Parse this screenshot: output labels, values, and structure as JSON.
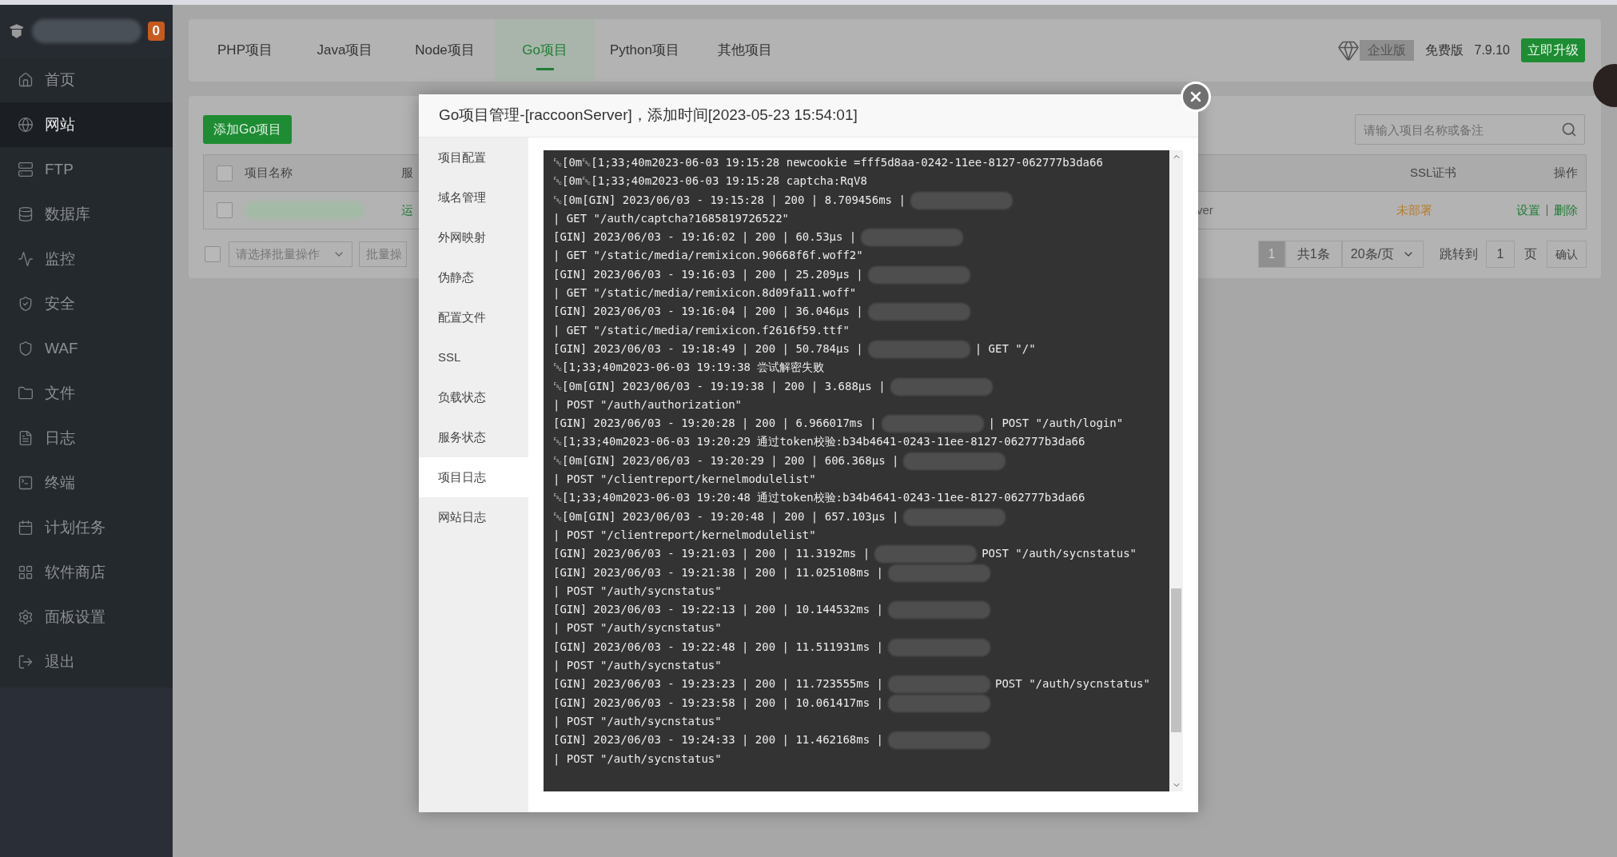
{
  "sidebar": {
    "badge": "0",
    "items": [
      {
        "label": "首页",
        "selected": false
      },
      {
        "label": "网站",
        "selected": true
      },
      {
        "label": "FTP",
        "selected": false
      },
      {
        "label": "数据库",
        "selected": false
      },
      {
        "label": "监控",
        "selected": false
      },
      {
        "label": "安全",
        "selected": false
      },
      {
        "label": "WAF",
        "selected": false
      },
      {
        "label": "文件",
        "selected": false
      },
      {
        "label": "日志",
        "selected": false
      },
      {
        "label": "终端",
        "selected": false
      },
      {
        "label": "计划任务",
        "selected": false
      },
      {
        "label": "软件商店",
        "selected": false
      },
      {
        "label": "面板设置",
        "selected": false
      },
      {
        "label": "退出",
        "selected": false
      }
    ]
  },
  "tabs": [
    {
      "label": "PHP项目",
      "selected": false
    },
    {
      "label": "Java项目",
      "selected": false
    },
    {
      "label": "Node项目",
      "selected": false
    },
    {
      "label": "Go项目",
      "selected": true
    },
    {
      "label": "Python项目",
      "selected": false
    },
    {
      "label": "其他项目",
      "selected": false
    }
  ],
  "edition": {
    "enterprise_label": "企业版",
    "free_label": "免费版",
    "version": "7.9.10",
    "upgrade_button": "立即升级"
  },
  "toolbar": {
    "add_button": "添加Go项目",
    "search": {
      "placeholder": "请输入项目名称或备注"
    }
  },
  "table": {
    "header_checked": false,
    "columns": [
      "项目名称",
      "服",
      "SSL证书",
      "操作"
    ],
    "rows": [
      {
        "checked": false,
        "status": "运",
        "column_3": "ver",
        "ssl": "未部署",
        "actions": [
          "设置",
          "删除"
        ]
      }
    ]
  },
  "batch": {
    "checked": false,
    "select_placeholder": "请选择批量操作",
    "button": "批量操"
  },
  "pagination": {
    "pages": [
      {
        "label": "1",
        "selected": true
      }
    ],
    "total": "共1条",
    "page_size": "20条/页",
    "goto_label": "跳转到",
    "goto_value": "1",
    "page_unit": "页",
    "confirm": "确认"
  },
  "dialog": {
    "title": "Go项目管理-[raccoonServer]，添加时间[2023-05-23 15:54:01]",
    "nav": [
      {
        "label": "项目配置",
        "selected": false
      },
      {
        "label": "域名管理",
        "selected": false
      },
      {
        "label": "外网映射",
        "selected": false
      },
      {
        "label": "伪静态",
        "selected": false
      },
      {
        "label": "配置文件",
        "selected": false
      },
      {
        "label": "SSL",
        "selected": false
      },
      {
        "label": "负载状态",
        "selected": false
      },
      {
        "label": "服务状态",
        "selected": false
      },
      {
        "label": "项目日志",
        "selected": true
      },
      {
        "label": "网站日志",
        "selected": false
      }
    ],
    "log": [
      {
        "text": "␛[0m␛[1;33;40m2023-06-03 19:15:28 newcookie =fff5d8aa-0242-11ee-8127-062777b3da66"
      },
      {
        "text": "␛[0m␛[1;33;40m2023-06-03 19:15:28 captcha:RqV8"
      },
      {
        "before": "␛[0m[GIN] 2023/06/03 - 19:15:28 | 200 | 8.709456ms |",
        "after": "| GET \"/auth/captcha?1685819726522\""
      },
      {
        "before": "[GIN] 2023/06/03 - 19:16:02 | 200 | 60.53µs |",
        "after": "| GET \"/static/media/remixicon.90668f6f.woff2\""
      },
      {
        "before": "[GIN] 2023/06/03 - 19:16:03 | 200 | 25.209µs |",
        "after": "| GET \"/static/media/remixicon.8d09fa11.woff\""
      },
      {
        "before": "[GIN] 2023/06/03 - 19:16:04 | 200 | 36.046µs |",
        "after": "| GET \"/static/media/remixicon.f2616f59.ttf\""
      },
      {
        "before": "[GIN] 2023/06/03 - 19:18:49 | 200 | 50.784µs |",
        "after": "| GET \"/\""
      },
      {
        "text": "␛[1;33;40m2023-06-03 19:19:38 尝试解密失败"
      },
      {
        "before": "␛[0m[GIN] 2023/06/03 - 19:19:38 | 200 | 3.688µs |",
        "after": "| POST \"/auth/authorization\""
      },
      {
        "before": "[GIN] 2023/06/03 - 19:20:28 | 200 | 6.966017ms |",
        "after": "| POST \"/auth/login\""
      },
      {
        "text": "␛[1;33;40m2023-06-03 19:20:29 通过token校验:b34b4641-0243-11ee-8127-062777b3da66"
      },
      {
        "before": "␛[0m[GIN] 2023/06/03 - 19:20:29 | 200 | 606.368µs |",
        "after": "| POST \"/clientreport/kernelmodulelist\""
      },
      {
        "text": "␛[1;33;40m2023-06-03 19:20:48 通过token校验:b34b4641-0243-11ee-8127-062777b3da66"
      },
      {
        "before": "␛[0m[GIN] 2023/06/03 - 19:20:48 | 200 | 657.103µs |",
        "after": "| POST \"/clientreport/kernelmodulelist\""
      },
      {
        "before": "[GIN] 2023/06/03 - 19:21:03 | 200 | 11.3192ms |",
        "after": "POST \"/auth/sycnstatus\""
      },
      {
        "before": "[GIN] 2023/06/03 - 19:21:38 | 200 | 11.025108ms |",
        "after": "| POST \"/auth/sycnstatus\""
      },
      {
        "before": "[GIN] 2023/06/03 - 19:22:13 | 200 | 10.144532ms |",
        "after": "| POST \"/auth/sycnstatus\""
      },
      {
        "before": "[GIN] 2023/06/03 - 19:22:48 | 200 | 11.511931ms |",
        "after": "| POST \"/auth/sycnstatus\""
      },
      {
        "before": "[GIN] 2023/06/03 - 19:23:23 | 200 | 11.723555ms |",
        "after": "POST \"/auth/sycnstatus\""
      },
      {
        "before": "[GIN] 2023/06/03 - 19:23:58 | 200 | 10.061417ms |",
        "after": "| POST \"/auth/sycnstatus\""
      },
      {
        "before": "[GIN] 2023/06/03 - 19:24:33 | 200 | 11.462168ms |",
        "after": "| POST \"/auth/sycnstatus\""
      }
    ]
  }
}
